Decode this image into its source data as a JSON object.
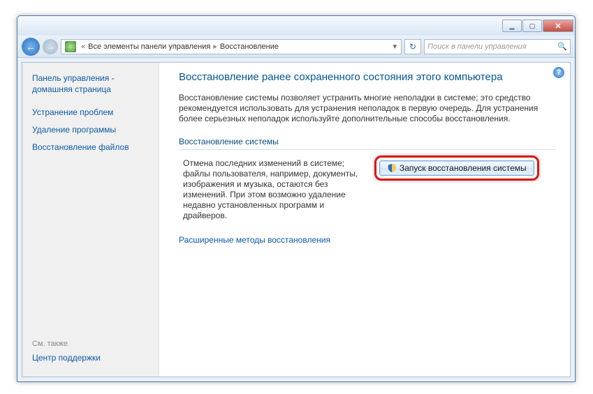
{
  "titlebar": {
    "minimize": "▁",
    "maximize": "▢",
    "close": "✕"
  },
  "nav": {
    "breadcrumb_root": "Все элементы панели управления",
    "breadcrumb_current": "Восстановление",
    "search_placeholder": "Поиск в панели управления"
  },
  "sidebar": {
    "home": "Панель управления - домашняя страница",
    "links": [
      "Устранение проблем",
      "Удаление программы",
      "Восстановление файлов"
    ],
    "see_also_label": "См. также",
    "see_also_link": "Центр поддержки"
  },
  "main": {
    "heading": "Восстановление ранее сохраненного состояния этого компьютера",
    "intro": "Восстановление системы позволяет устранить многие неполадки в системе; это средство рекомендуется использовать для устранения неполадок в первую очередь. Для устранения более серьезных неполадок используйте дополнительные способы восстановления.",
    "section_title": "Восстановление системы",
    "section_desc": "Отмена последних изменений в системе; файлы пользователя, например, документы, изображения и музыка, остаются без изменений. При этом возможно удаление недавно установленных программ и драйверов.",
    "button_label": "Запуск восстановления системы",
    "advanced_link": "Расширенные методы восстановления"
  }
}
